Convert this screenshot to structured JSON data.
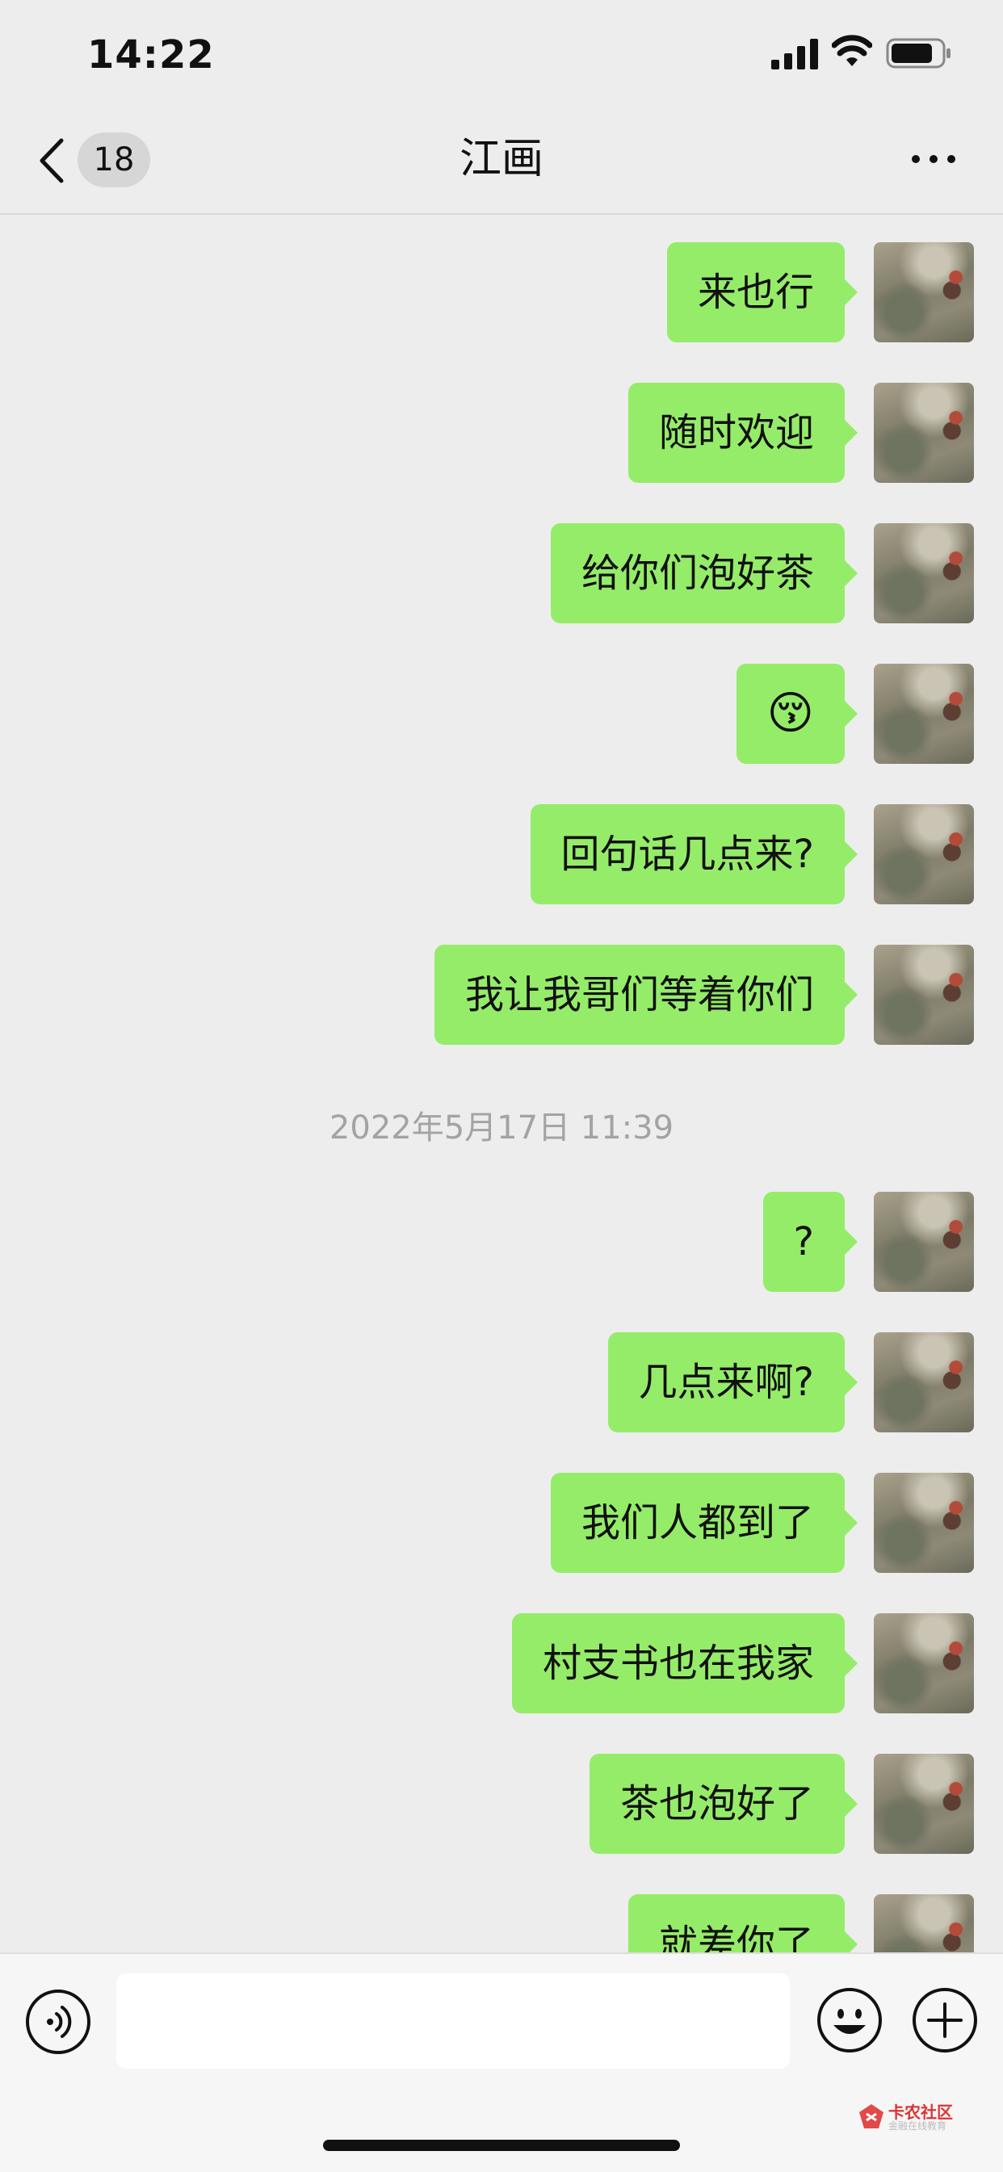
{
  "status_bar": {
    "time": "14:22"
  },
  "nav": {
    "unread_count": "18",
    "title": "江画"
  },
  "messages": [
    {
      "type": "text",
      "text": "来也行"
    },
    {
      "type": "text",
      "text": "随时欢迎"
    },
    {
      "type": "text",
      "text": "给你们泡好茶"
    },
    {
      "type": "emoji",
      "text": "😚"
    },
    {
      "type": "text",
      "text": "回句话几点来?"
    },
    {
      "type": "text",
      "text": "我让我哥们等着你们"
    },
    {
      "type": "timestamp",
      "text": "2022年5月17日 11:39"
    },
    {
      "type": "text",
      "text": "?"
    },
    {
      "type": "text",
      "text": "几点来啊?"
    },
    {
      "type": "text",
      "text": "我们人都到了"
    },
    {
      "type": "text",
      "text": "村支书也在我家"
    },
    {
      "type": "text",
      "text": "茶也泡好了"
    },
    {
      "type": "text",
      "text": "就差你了"
    }
  ],
  "watermark": {
    "title": "卡农社区",
    "subtitle": "金融在线教育"
  },
  "colors": {
    "bubble": "#95ec69",
    "background": "#ededed",
    "input_bar": "#f6f6f6"
  }
}
